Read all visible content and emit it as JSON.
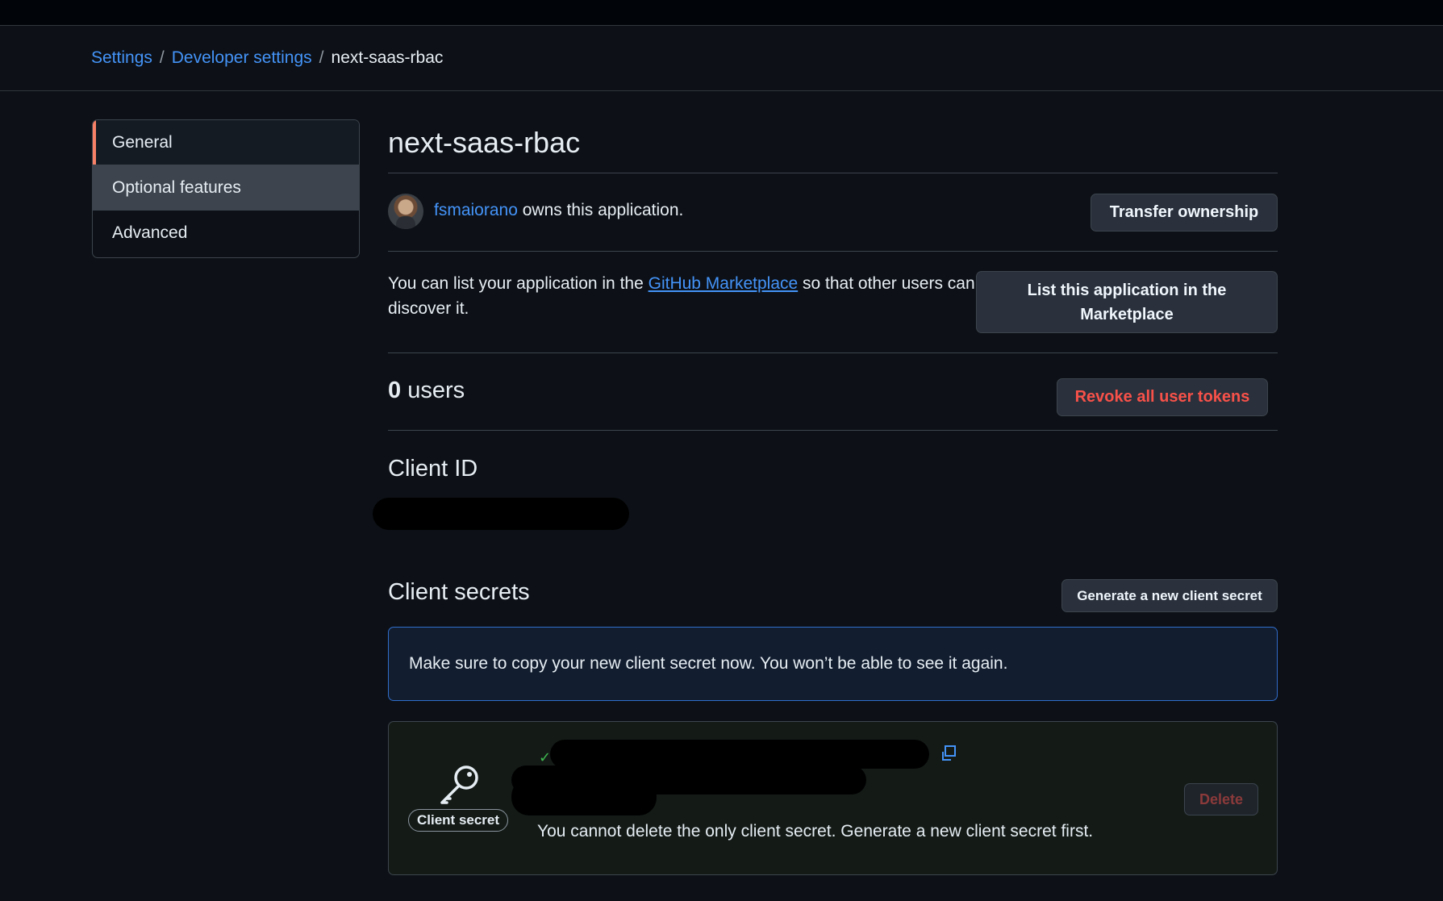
{
  "breadcrumb": {
    "items": [
      "Settings",
      "Developer settings"
    ],
    "separator": "/",
    "current": "next-saas-rbac"
  },
  "sidebar": {
    "items": [
      {
        "label": "General",
        "selected": true
      },
      {
        "label": "Optional features",
        "selected": false
      },
      {
        "label": "Advanced",
        "selected": false
      }
    ]
  },
  "app": {
    "title": "next-saas-rbac",
    "owner_name": "fsmaiorano",
    "owner_suffix": " owns this application.",
    "transfer_button": "Transfer ownership"
  },
  "marketplace": {
    "text_before": "You can list your application in the ",
    "link_text": "GitHub Marketplace",
    "text_after": " so that other users can discover it.",
    "button": "List this application in the Marketplace"
  },
  "users": {
    "count": "0",
    "label": " users",
    "revoke_button": "Revoke all user tokens"
  },
  "client_id": {
    "heading": "Client ID"
  },
  "client_secrets": {
    "heading": "Client secrets",
    "generate_button": "Generate a new client secret",
    "flash_message": "Make sure to copy your new client secret now. You won’t be able to see it again.",
    "secret_label": "Client secret",
    "delete_button": "Delete",
    "delete_warning": "You cannot delete the only client secret. Generate a new client secret first."
  },
  "colors": {
    "background": "#0d1117",
    "link": "#4493f8",
    "danger": "#f85149",
    "success": "#3fb950",
    "accent_selected": "#f78166"
  }
}
